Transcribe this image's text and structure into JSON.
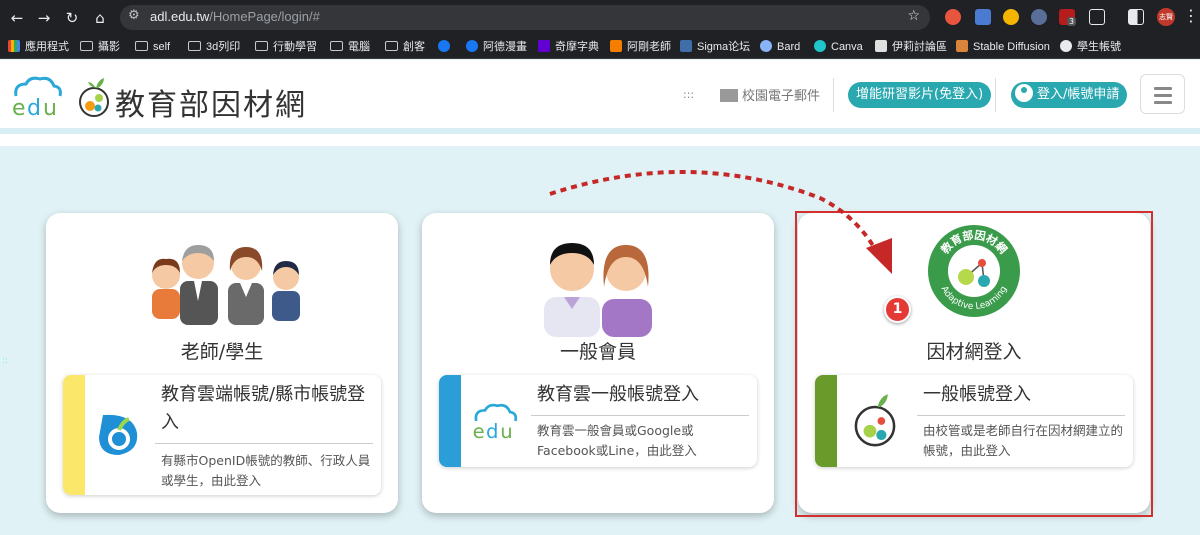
{
  "browser": {
    "url_host": "adl.edu.tw",
    "url_path": "/HomePage/login/#",
    "bookmarks": [
      {
        "label": "應用程式",
        "icon": "apps-grid-icon"
      },
      {
        "label": "攝影",
        "icon": "folder-icon"
      },
      {
        "label": "self",
        "icon": "folder-icon"
      },
      {
        "label": "3d列印",
        "icon": "folder-icon"
      },
      {
        "label": "行動學習",
        "icon": "folder-icon"
      },
      {
        "label": "電腦",
        "icon": "folder-icon"
      },
      {
        "label": "創客",
        "icon": "folder-icon"
      },
      {
        "label": "",
        "icon": "facebook-icon"
      },
      {
        "label": "阿德漫畫",
        "icon": "facebook-icon"
      },
      {
        "label": "奇摩字典",
        "icon": "yahoo-icon"
      },
      {
        "label": "阿剛老師",
        "icon": "blogger-icon"
      },
      {
        "label": "Sigma论坛",
        "icon": "sigma-icon"
      },
      {
        "label": "Bard",
        "icon": "bard-icon"
      },
      {
        "label": "Canva",
        "icon": "canva-icon"
      },
      {
        "label": "伊莉討論區",
        "icon": "eyny-icon"
      },
      {
        "label": "Stable Diffusion",
        "icon": "stable-diffusion-icon"
      },
      {
        "label": "學生帳號",
        "icon": "globe-icon"
      }
    ],
    "profile_label": "志賢",
    "ext_badge": "3"
  },
  "header": {
    "site_title": "教育部因材網",
    "dots": ":::",
    "mail_label": "校園電子郵件",
    "video_button": "增能研習影片(免登入)",
    "login_button": "登入/帳號申請"
  },
  "cards": [
    {
      "title": "老師/學生",
      "login_heading": "教育雲端帳號/縣市帳號登入",
      "login_desc": "有縣市OpenID帳號的教師、行政人員或學生，由此登入",
      "bar_color": "#fbe86a"
    },
    {
      "title": "一般會員",
      "login_heading": "教育雲一般帳號登入",
      "login_desc": "教育雲一般會員或Google或Facebook或Line，由此登入",
      "bar_color": "#2b9ed8"
    },
    {
      "title": "因材網登入",
      "login_heading": "一般帳號登入",
      "login_desc": "由校管或是老師自行在因材網建立的帳號，由此登入",
      "bar_color": "#6a9a2a"
    }
  ],
  "adl_emblem": {
    "top_text": "教育部因材網",
    "bottom_text": "Adaptive Learning"
  },
  "annotation": {
    "step_number": "1",
    "highlight_color": "#d32f2f"
  }
}
